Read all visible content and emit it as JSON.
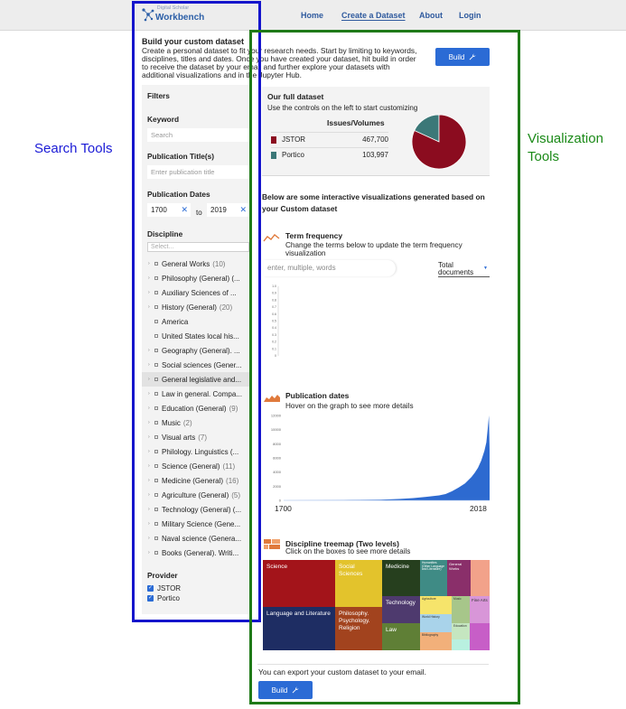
{
  "nav": {
    "logo_small": "Digital Scholar",
    "logo_main": "Workbench",
    "items": [
      "Home",
      "Create a Dataset",
      "About",
      "Login"
    ]
  },
  "annotations": {
    "search_tools": "Search Tools",
    "visualization_tools": "Visualization Tools"
  },
  "intro": {
    "title": "Build your custom dataset",
    "text": "Create a personal dataset to fit your research needs. Start by limiting to keywords, disciplines, titles and dates. Once you have created your dataset, hit build in order to receive the dataset by your email and further explore your datasets with additional visualizations and in the Jupyter Hub.",
    "build_label": "Build"
  },
  "filters": {
    "title": "Filters",
    "keyword_label": "Keyword",
    "keyword_placeholder": "Search",
    "pubtitle_label": "Publication Title(s)",
    "pubtitle_placeholder": "Enter publication title",
    "dates_label": "Publication Dates",
    "date_from": "1700",
    "date_to": "2019",
    "to_label": "to",
    "clear_glyph": "✕",
    "discipline_label": "Discipline",
    "discipline_select": "Select...",
    "disciplines": [
      {
        "label": "General Works",
        "count": "(10)"
      },
      {
        "label": "Philosophy (General) (...",
        "count": ""
      },
      {
        "label": "Auxiliary Sciences of ...",
        "count": ""
      },
      {
        "label": "History (General)",
        "count": "(20)"
      },
      {
        "label": "America",
        "count": ""
      },
      {
        "label": "United States local his...",
        "count": ""
      },
      {
        "label": "Geography (General). ...",
        "count": ""
      },
      {
        "label": "Social sciences (Gener...",
        "count": ""
      },
      {
        "label": "General legislative and...",
        "count": ""
      },
      {
        "label": "Law in general. Compa...",
        "count": ""
      },
      {
        "label": "Education (General)",
        "count": "(9)"
      },
      {
        "label": "Music",
        "count": "(2)"
      },
      {
        "label": "Visual arts",
        "count": "(7)"
      },
      {
        "label": "Philology. Linguistics (...",
        "count": ""
      },
      {
        "label": "Science (General)",
        "count": "(11)"
      },
      {
        "label": "Medicine (General)",
        "count": "(16)"
      },
      {
        "label": "Agriculture (General)",
        "count": "(5)"
      },
      {
        "label": "Technology (General) (...",
        "count": ""
      },
      {
        "label": "Military Science (Gene...",
        "count": ""
      },
      {
        "label": "Naval science (Genera...",
        "count": ""
      },
      {
        "label": "Books (General). Writi...",
        "count": ""
      }
    ],
    "provider_label": "Provider",
    "providers": [
      "JSTOR",
      "Portico"
    ]
  },
  "dataset": {
    "title": "Our full dataset",
    "subtitle": "Use the controls on the left to start customizing",
    "column_header": "Issues/Volumes",
    "rows": [
      {
        "name": "JSTOR",
        "value": "467,700"
      },
      {
        "name": "Portico",
        "value": "103,997"
      }
    ]
  },
  "colors": {
    "jstor": "#8b0c1f",
    "portico": "#3b7878",
    "accent": "#2b6bd5"
  },
  "vis": {
    "intro": "Below are some interactive visualizations generated based on your Custom dataset",
    "term_title": "Term frequency",
    "term_sub": "Change the terms below to update the term frequency visualization",
    "term_placeholder": "enter, multiple, words",
    "term_select": "Total documents",
    "term_select_arrow": "▼",
    "pub_title": "Publication dates",
    "pub_sub": "Hover on the graph to see more details",
    "pub_x_start": "1700",
    "pub_x_end": "2018",
    "tree_title": "Discipline treemap (Two levels)",
    "tree_sub": "Click on the boxes to see more details",
    "treemap": {
      "science": "Science",
      "social": "Social Sciences",
      "medicine": "Medicine",
      "humanities": "Humanities (Other Language and Literature)",
      "general": "General Works",
      "language": "Language and Literature",
      "technology": "Technology",
      "philosophy": "Philosophy. Psychology. Religion",
      "law": "Law",
      "fine_arts": "Fine Arts",
      "agriculture": "Agriculture",
      "worldhistory": "World History",
      "music": "Music",
      "t1": "Bibliography",
      "t2": "Education"
    }
  },
  "export": {
    "text": "You can export your custom dataset to your email.",
    "build_label": "Build"
  },
  "chart_data": [
    {
      "type": "pie",
      "categories": [
        "JSTOR",
        "Portico"
      ],
      "values": [
        467700,
        103997
      ]
    },
    {
      "type": "line",
      "ylim": [
        0,
        1
      ],
      "y_ticks": [
        "0",
        "0.1",
        "0.2",
        "0.3",
        "0.4",
        "0.5",
        "0.6",
        "0.7",
        "0.8",
        "0.9",
        "1.0"
      ],
      "x": [],
      "values": []
    },
    {
      "type": "area",
      "x": [
        1700,
        1750,
        1800,
        1850,
        1880,
        1900,
        1920,
        1940,
        1950,
        1960,
        1970,
        1980,
        1990,
        1995,
        2000,
        2005,
        2010,
        2013,
        2015,
        2016,
        2017,
        2018
      ],
      "values": [
        0,
        10,
        40,
        100,
        200,
        320,
        500,
        700,
        900,
        1300,
        1800,
        2400,
        3300,
        3900,
        4600,
        5600,
        7000,
        8200,
        10000,
        11000,
        12000,
        7000
      ],
      "ylim": [
        0,
        12000
      ],
      "y_ticks": [
        "0",
        "2000",
        "4000",
        "6000",
        "8000",
        "10000",
        "12000"
      ],
      "xlim": [
        1700,
        2018
      ]
    }
  ]
}
